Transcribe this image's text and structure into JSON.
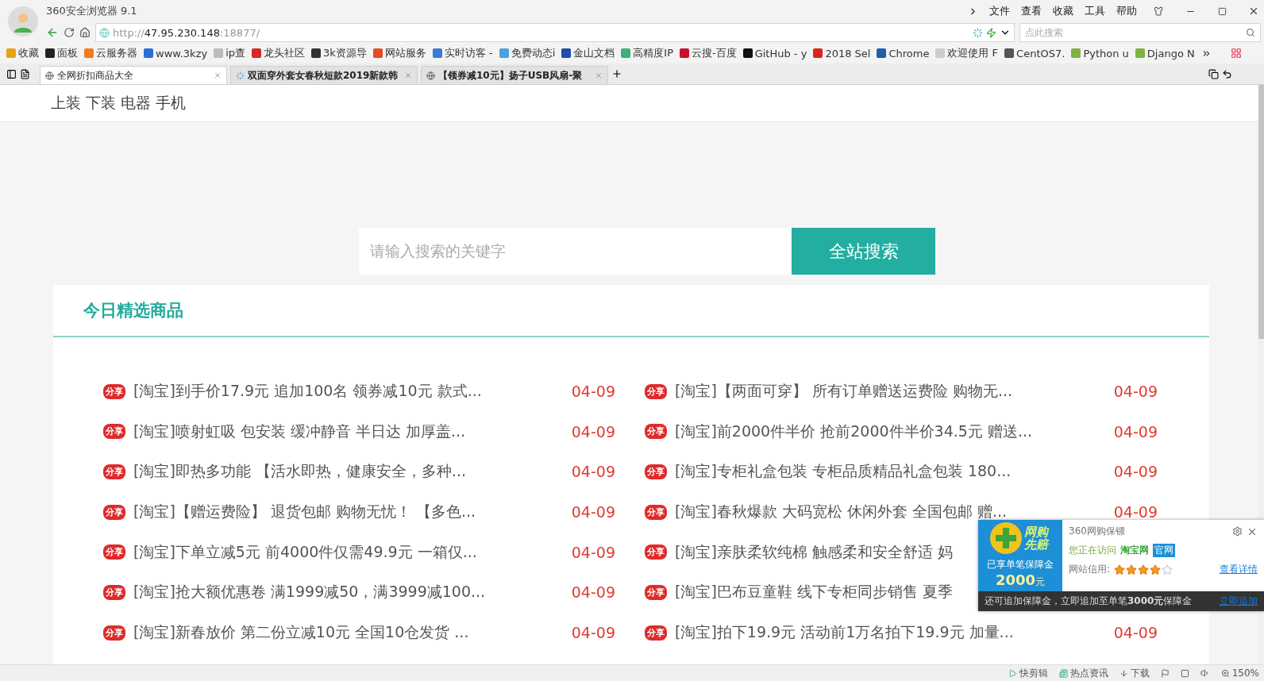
{
  "window": {
    "title": "360安全浏览器 9.1",
    "menu": [
      "文件",
      "查看",
      "收藏",
      "工具",
      "帮助"
    ]
  },
  "address_bar": {
    "scheme": "http://",
    "host": "47.95.230.148",
    "port": ":18877/",
    "search_placeholder": "点此搜索"
  },
  "bookmarks": [
    {
      "label": "收藏",
      "color": "#e8a317"
    },
    {
      "label": "面板",
      "color": "#222222"
    },
    {
      "label": "云服务器",
      "color": "#f07c1b"
    },
    {
      "label": "www.3kzy",
      "color": "#2a6fd6"
    },
    {
      "label": "ip查",
      "color": "#bbbbbb"
    },
    {
      "label": "龙头社区",
      "color": "#d22a2a"
    },
    {
      "label": "3k资源导",
      "color": "#333333"
    },
    {
      "label": "网站服务",
      "color": "#e34c26"
    },
    {
      "label": "实时访客 -",
      "color": "#3a7bd5"
    },
    {
      "label": "免费动态i",
      "color": "#4aa3df"
    },
    {
      "label": "金山文档",
      "color": "#1b4fa8"
    },
    {
      "label": "高精度IP",
      "color": "#3fb07a"
    },
    {
      "label": "云搜-百度",
      "color": "#c8102e"
    },
    {
      "label": "GitHub - y",
      "color": "#111111"
    },
    {
      "label": "2018 Sel",
      "color": "#d9261c"
    },
    {
      "label": "Chrome",
      "color": "#1f5fa8"
    },
    {
      "label": "欢迎使用 F",
      "color": "#cccccc"
    },
    {
      "label": "CentOS7.",
      "color": "#555555"
    },
    {
      "label": "Python u",
      "color": "#7fb241"
    },
    {
      "label": "Django N",
      "color": "#7fb241"
    }
  ],
  "tabs": [
    {
      "label": "全网折扣商品大全",
      "selected": true,
      "loading": false
    },
    {
      "label": "双面穿外套女春秋短款2019新款韩",
      "selected": false,
      "loading": true
    },
    {
      "label": "【领券减10元】扬子USB风扇-聚",
      "selected": false,
      "loading": false
    }
  ],
  "page": {
    "nav": [
      "上装",
      "下装",
      "电器",
      "手机"
    ],
    "search": {
      "placeholder": "请输入搜索的关键字",
      "button": "全站搜索"
    },
    "section": {
      "title": "今日精选商品",
      "items": [
        {
          "tag": "分享",
          "title": "[淘宝]到手价17.9元 追加100名 领券减10元 款式...",
          "date": "04-09"
        },
        {
          "tag": "分享",
          "title": "[淘宝]【两面可穿】 所有订单赠送运费险 购物无...",
          "date": "04-09"
        },
        {
          "tag": "分享",
          "title": "[淘宝]喷射虹吸 包安装 缓冲静音 半日达 加厚盖...",
          "date": "04-09"
        },
        {
          "tag": "分享",
          "title": "[淘宝]前2000件半价 抢前2000件半价34.5元 赠送...",
          "date": "04-09"
        },
        {
          "tag": "分享",
          "title": "[淘宝]即热多功能 【活水即热，健康安全，多种...",
          "date": "04-09"
        },
        {
          "tag": "分享",
          "title": "[淘宝]专柜礼盒包装 专柜品质精品礼盒包装 180...",
          "date": "04-09"
        },
        {
          "tag": "分享",
          "title": "[淘宝]【赠运费险】 退货包邮 购物无忧！ 【多色...",
          "date": "04-09"
        },
        {
          "tag": "分享",
          "title": "[淘宝]春秋爆款 大码宽松 休闲外套 全国包邮 赠...",
          "date": "04-09"
        },
        {
          "tag": "分享",
          "title": "[淘宝]下单立减5元 前4000件仅需49.9元 一箱仅...",
          "date": "04-09"
        },
        {
          "tag": "分享",
          "title": "[淘宝]亲肤柔软纯棉 触感柔和安全舒适 妈"
        },
        {
          "tag": "分享",
          "title": "[淘宝]抢大额优惠卷 满1999减50，满3999减100...",
          "date": "04-09"
        },
        {
          "tag": "分享",
          "title": "[淘宝]巴布豆童鞋 线下专柜同步销售 夏季"
        },
        {
          "tag": "分享",
          "title": "[淘宝]新春放价 第二份立减10元 全国10仓发货 ...",
          "date": "04-09"
        },
        {
          "tag": "分享",
          "title": "[淘宝]拍下19.9元 活动前1万名拍下19.9元 加量...",
          "date": "04-09"
        }
      ]
    }
  },
  "popup": {
    "logo_lines": [
      "网购",
      "先赔"
    ],
    "guarantee": "已享单笔保障金",
    "amount": "2000",
    "unit": "元",
    "title": "360网购保镖",
    "visiting": "您正在访问",
    "site": "淘宝网",
    "badge": "官网",
    "credit_label": "网站信用:",
    "stars": 4,
    "details_link": "查看详情",
    "footer": "还可追加保障金，立即追加至单笔**3000元**保障金",
    "footer_link": "立即追加"
  },
  "status_bar": {
    "items": [
      "快剪辑",
      "热点资讯",
      "下载"
    ],
    "zoom": "150%"
  }
}
